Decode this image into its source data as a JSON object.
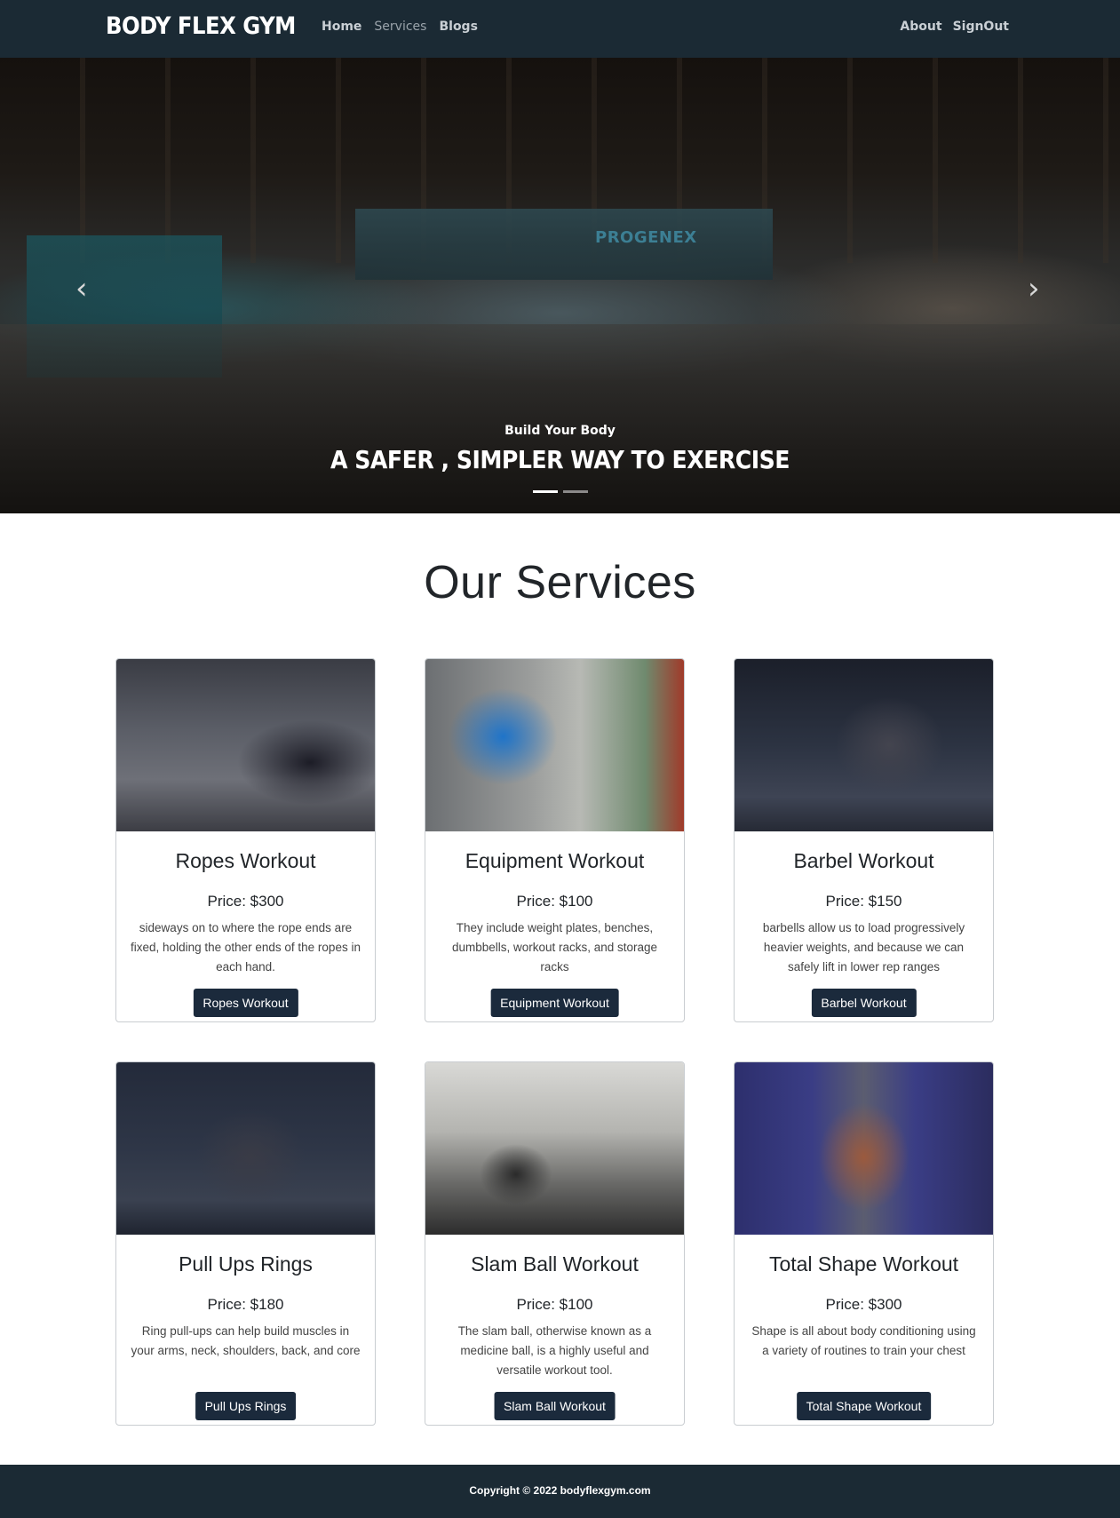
{
  "navbar": {
    "brand": "BODY FLEX GYM",
    "left_links": [
      "Home",
      "Services",
      "Blogs"
    ],
    "right_links": [
      "About",
      "SignOut"
    ]
  },
  "hero": {
    "subtitle": "Build Your Body",
    "title": "A SAFER , SIMPLER WAY TO EXERCISE",
    "wall_sign": "PROGENEX",
    "prev_arrow": "‹",
    "next_arrow": "›",
    "slide_count": 2,
    "active_slide": 1
  },
  "services": {
    "title": "Our Services",
    "cards": [
      {
        "title": "Ropes Workout",
        "price": "Price: $300",
        "description": "sideways on to where the rope ends are fixed, holding the other ends of the ropes in each hand.",
        "button": "Ropes Workout"
      },
      {
        "title": "Equipment Workout",
        "price": "Price: $100",
        "description": "They include weight plates, benches, dumbbells, workout racks, and storage racks",
        "button": "Equipment Workout"
      },
      {
        "title": "Barbel Workout",
        "price": "Price: $150",
        "description": "barbells allow us to load progressively heavier weights, and because we can safely lift in lower rep ranges",
        "button": "Barbel Workout"
      },
      {
        "title": "Pull Ups Rings",
        "price": "Price: $180",
        "description": "Ring pull-ups can help build muscles in your arms, neck, shoulders, back, and core",
        "button": "Pull Ups Rings"
      },
      {
        "title": "Slam Ball Workout",
        "price": "Price: $100",
        "description": "The slam ball, otherwise known as a medicine ball, is a highly useful and versatile workout tool.",
        "button": "Slam Ball Workout"
      },
      {
        "title": "Total Shape Workout",
        "price": "Price: $300",
        "description": "Shape is all about body conditioning using a variety of routines to train your chest",
        "button": "Total Shape Workout"
      }
    ]
  },
  "footer": {
    "copyright": "Copyright © 2022 bodyflexgym.com"
  },
  "colors": {
    "navbar_bg": "#1b2a34",
    "button_bg": "#1b2a3c",
    "footer_bg": "#1b2a34"
  }
}
